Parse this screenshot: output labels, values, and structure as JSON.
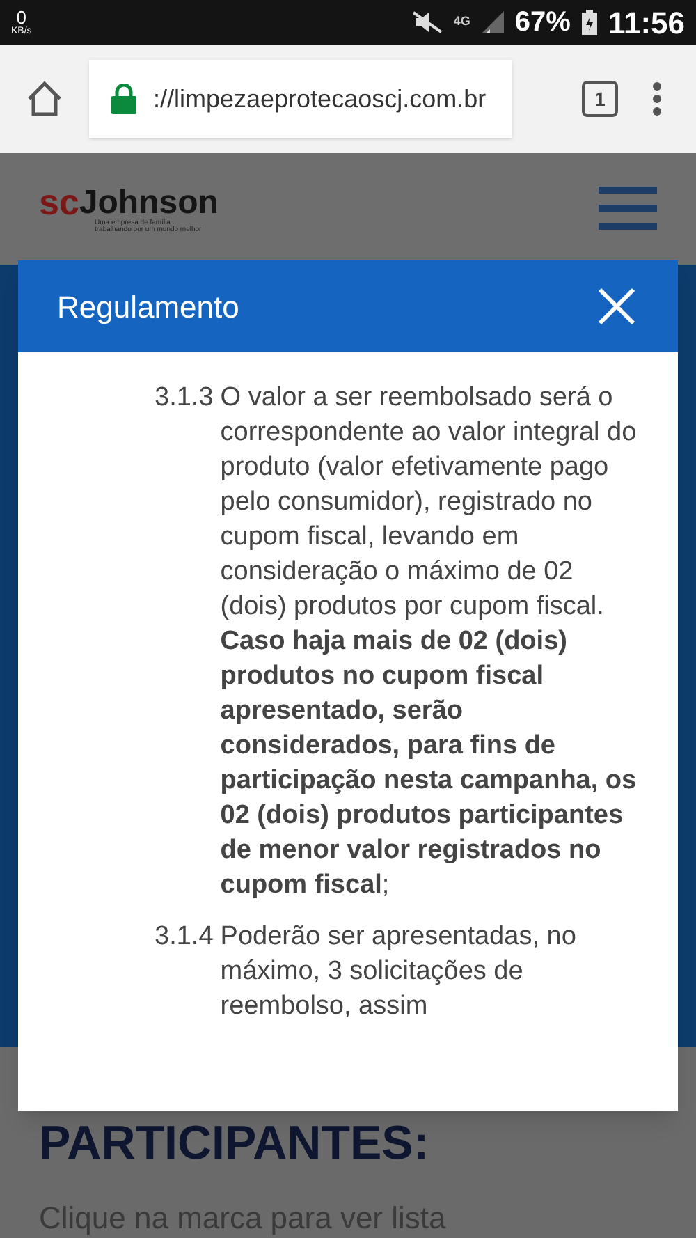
{
  "status_bar": {
    "speed_value": "0",
    "speed_unit": "KB/s",
    "network": "4G",
    "battery": "67%",
    "time": "11:56"
  },
  "browser": {
    "url": "://limpezaeprotecaoscj.com.br",
    "secure": true,
    "tab_count": "1"
  },
  "site": {
    "logo_prefix": "sc",
    "logo_name": "Johnson",
    "tagline": [
      "Uma empresa de família",
      "trabalhando por um mundo melhor"
    ],
    "heading": "PARTICIPANTES:",
    "text": "Clique na marca para ver lista"
  },
  "modal": {
    "title": "Regulamento",
    "items": [
      {
        "number": "3.1.3",
        "text": "O valor a ser reembolsado será o correspondente ao valor integral do produto (valor efetivamente pago pelo consumidor), registrado no cupom fiscal, levando em consideração o máximo de 02 (dois) produtos por cupom fiscal. **Caso haja mais de 02 (dois) produtos no cupom fiscal apresentado, serão considerados, para fins de participação nesta campanha, os 02 (dois) produtos participantes de menor valor registrados no cupom fiscal**;"
      },
      {
        "number": "3.1.4",
        "text": "Poderão ser apresentadas, no máximo, 3 solicitações de reembolso, assim"
      }
    ]
  }
}
